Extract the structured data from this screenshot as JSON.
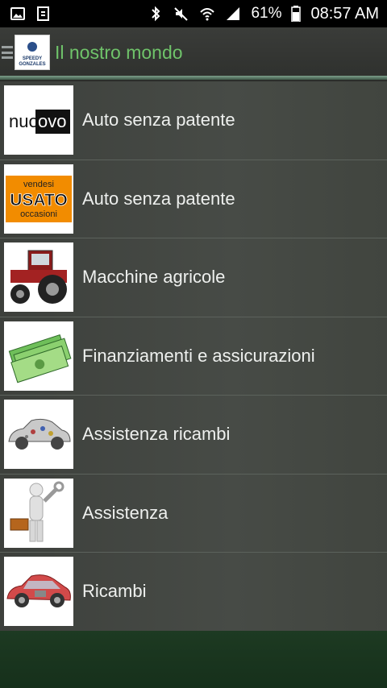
{
  "status_bar": {
    "battery_percent": "61%",
    "time": "08:57 AM"
  },
  "header": {
    "logo_text": "SPEEDY GONZALES",
    "title": "Il nostro mondo"
  },
  "colors": {
    "title_green": "#6fc36a",
    "row_text": "#eef0ee",
    "footer_green": "#1d3a22"
  },
  "menu": {
    "items": [
      {
        "label": "Auto senza patente",
        "icon": "nuovo-badge-icon",
        "badge": "nuovo"
      },
      {
        "label": "Auto senza patente",
        "icon": "usato-badge-icon",
        "badge_top": "vendesi",
        "badge_mid": "USATO",
        "badge_bottom": "occasioni"
      },
      {
        "label": "Macchine agricole",
        "icon": "tractor-icon"
      },
      {
        "label": "Finanziamenti e assicurazioni",
        "icon": "money-icon"
      },
      {
        "label": "Assistenza ricambi",
        "icon": "car-parts-icon"
      },
      {
        "label": "Assistenza",
        "icon": "mechanic-icon"
      },
      {
        "label": "Ricambi",
        "icon": "car-cutaway-icon"
      }
    ]
  }
}
